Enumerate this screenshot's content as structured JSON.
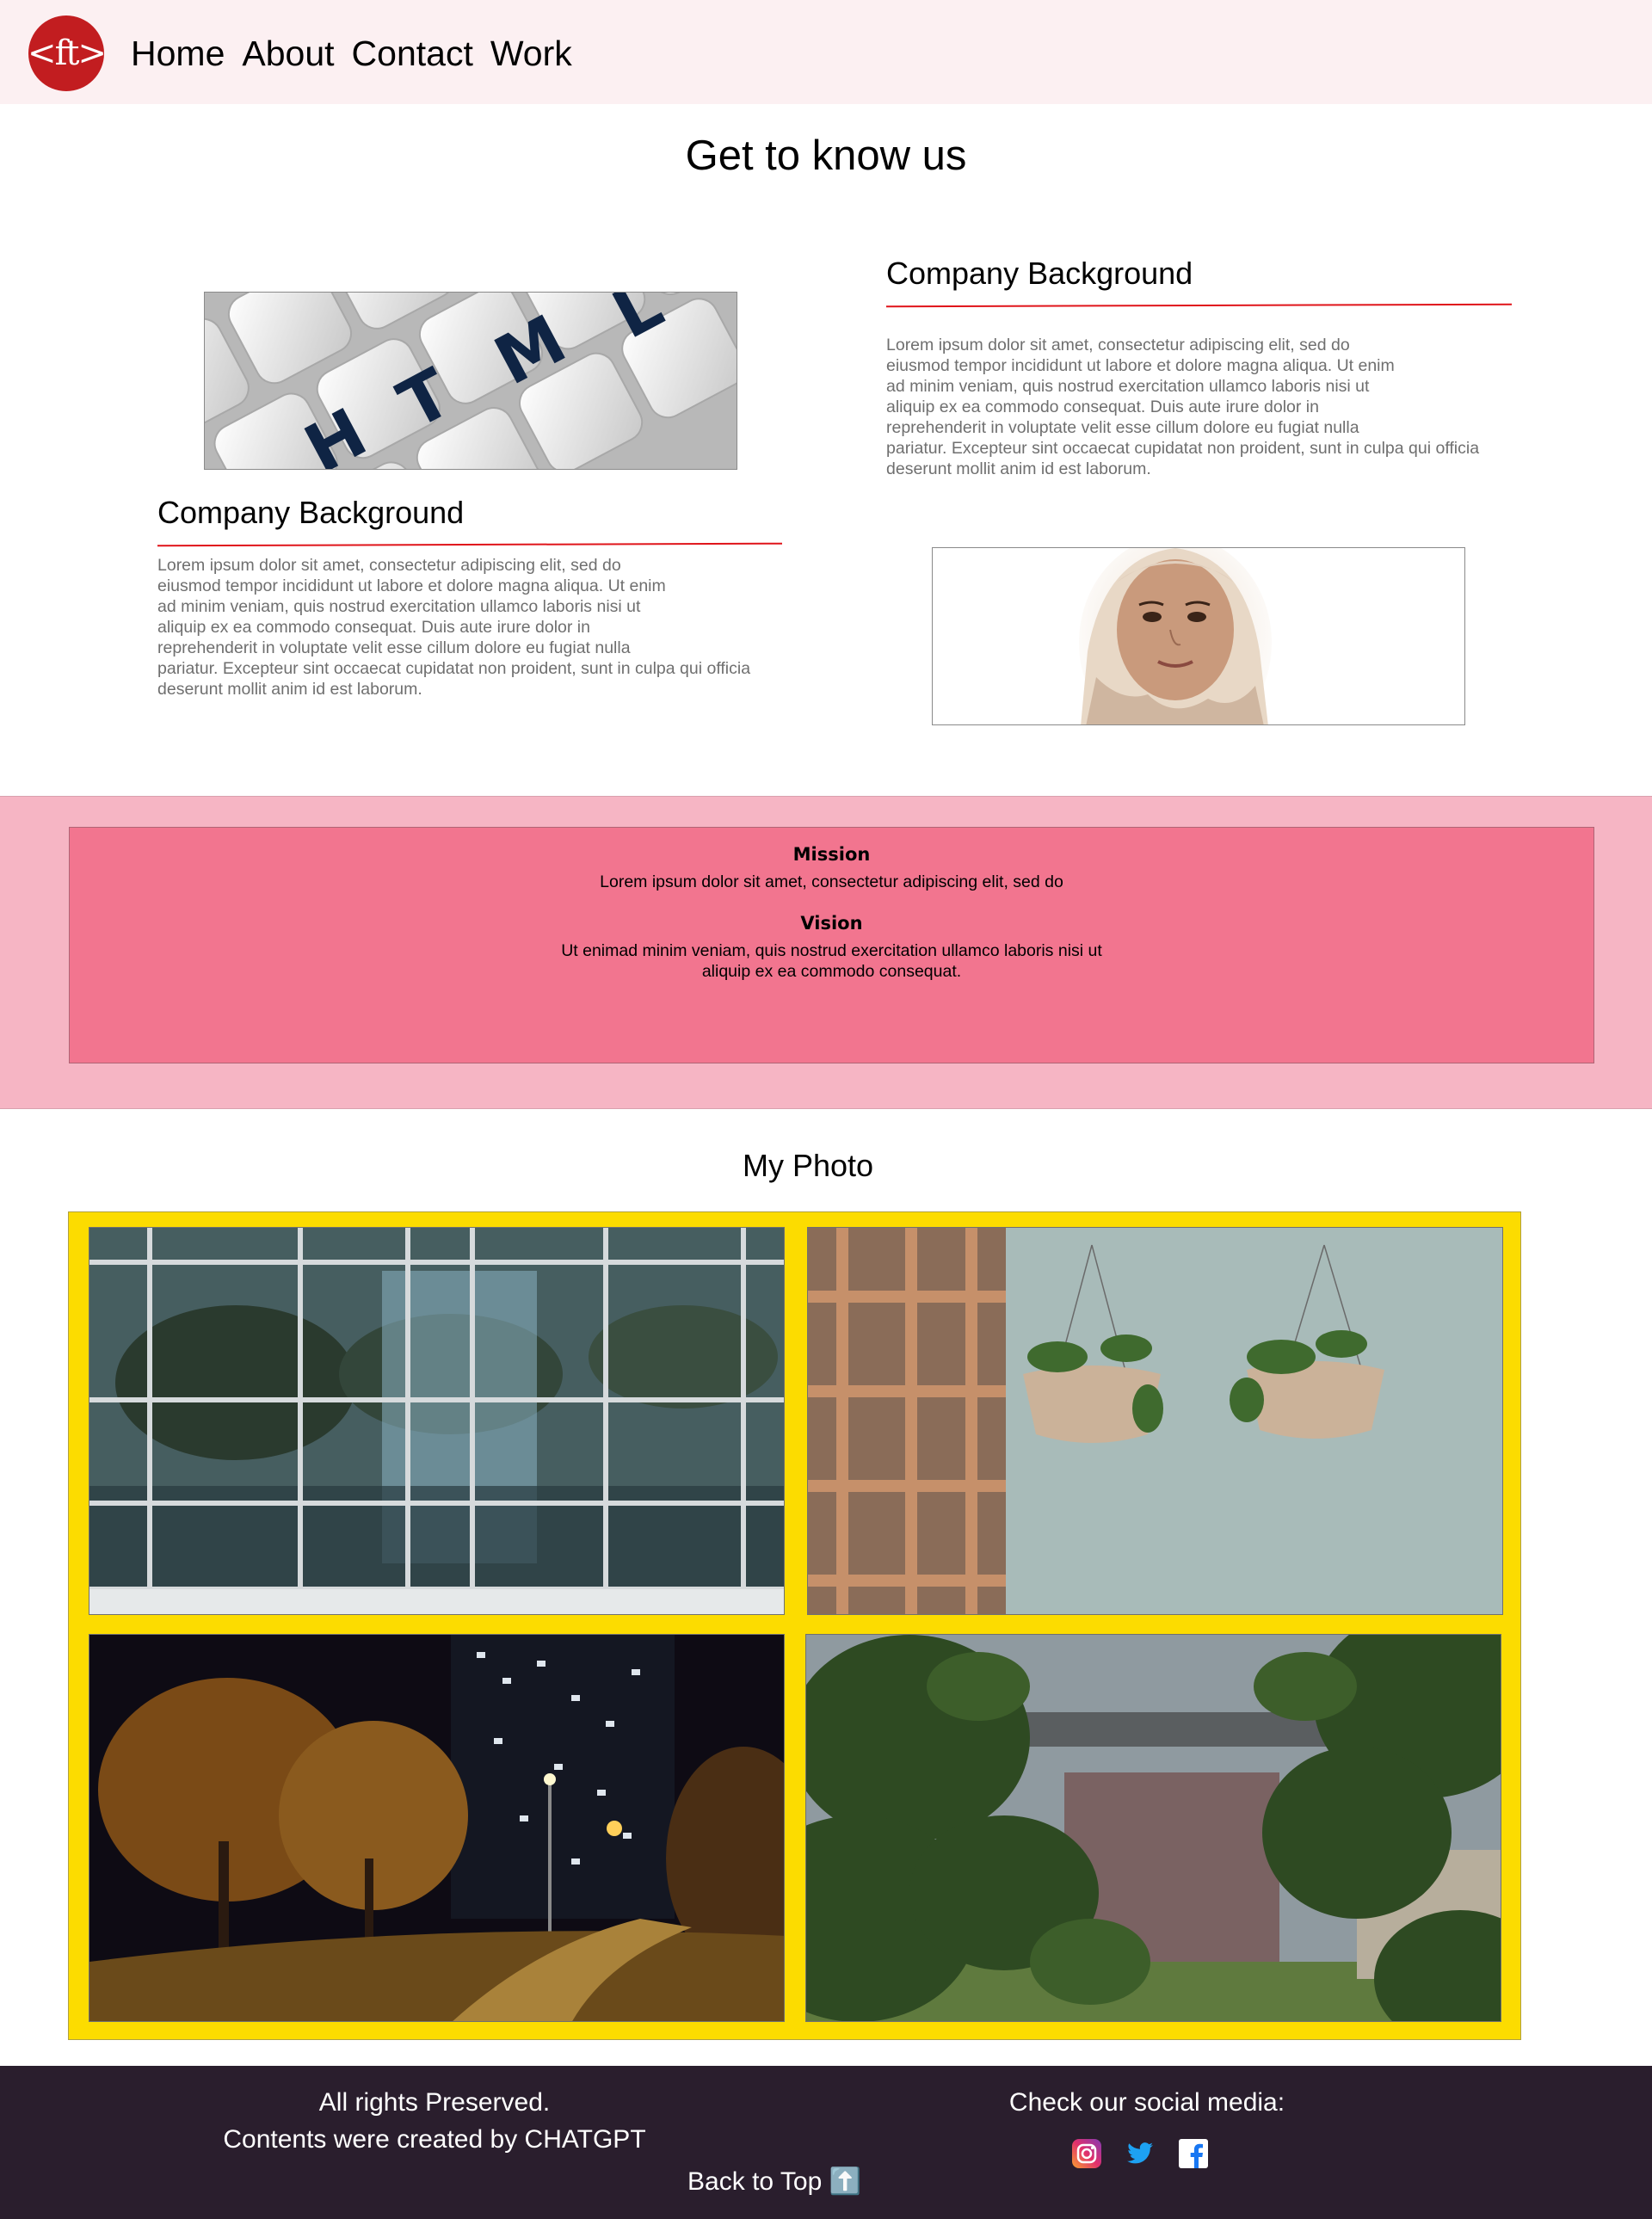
{
  "header": {
    "logo_text": "<ft>",
    "nav": [
      "Home",
      "About",
      "Contact",
      "Work"
    ]
  },
  "page_title": "Get to know us",
  "background_right": {
    "title": "Company Background",
    "text": "Lorem ipsum dolor sit amet, consectetur adipiscing elit, sed do\neiusmod tempor incididunt ut labore et dolore magna aliqua. Ut enim\nad minim veniam, quis nostrud exercitation ullamco laboris nisi ut\naliquip ex ea commodo consequat. Duis aute irure dolor in\nreprehenderit in voluptate velit esse cillum dolore eu fugiat nulla\npariatur. Excepteur sint occaecat cupidatat non proident, sunt in culpa qui officia\ndeserunt mollit anim id est laborum."
  },
  "background_left": {
    "title": "Company Background",
    "text": "Lorem ipsum dolor sit amet, consectetur adipiscing elit, sed do\neiusmod tempor incididunt ut labore et dolore magna aliqua. Ut enim\nad minim veniam, quis nostrud exercitation ullamco laboris nisi ut\naliquip ex ea commodo consequat. Duis aute irure dolor in\nreprehenderit in voluptate velit esse cillum dolore eu fugiat nulla\npariatur. Excepteur sint occaecat cupidatat non proident, sunt in culpa qui officia\ndeserunt mollit anim id est laborum."
  },
  "html_image_letters": [
    "H",
    "T",
    "M",
    "L"
  ],
  "mission": {
    "mission_heading": "Mission",
    "mission_text": "Lorem ipsum dolor sit amet, consectetur adipiscing elit, sed do",
    "vision_heading": "Vision",
    "vision_text": "Ut enimad minim veniam, quis nostrud exercitation ullamco laboris nisi ut\naliquip ex ea commodo consequat."
  },
  "photos": {
    "title": "My Photo"
  },
  "footer": {
    "rights": "All rights Preserved.",
    "credit": "Contents were created by CHATGPT",
    "social_label": "Check our social media:",
    "back_to_top": "Back to Top ⬆️",
    "social_icons": [
      "instagram-icon",
      "twitter-icon",
      "facebook-icon"
    ]
  },
  "colors": {
    "header_bg": "#fcf0f2",
    "logo_red": "#c21d20",
    "accent_line": "#e0141a",
    "band_bg": "#f6b5c4",
    "mission_bg": "#f2758f",
    "gallery_bg": "#fcdc00",
    "footer_bg": "#2a1e2d"
  }
}
